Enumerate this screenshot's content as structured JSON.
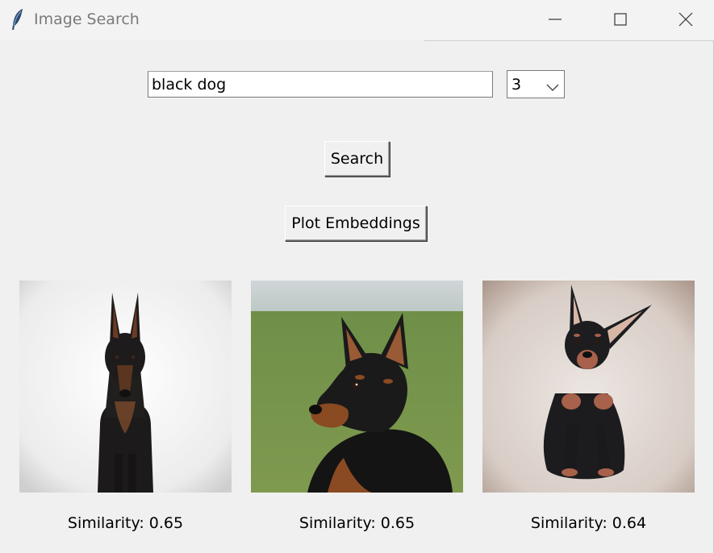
{
  "window": {
    "title": "Image Search",
    "icon": "feather-icon",
    "controls": [
      "minimize-icon",
      "maximize-icon",
      "close-icon"
    ]
  },
  "search": {
    "query": "black dog",
    "count_selected": "3",
    "search_label": "Search",
    "plot_label": "Plot Embeddings"
  },
  "results": [
    {
      "label": "Similarity: 0.65",
      "image": "doberman-front-white-background"
    },
    {
      "label": "Similarity: 0.65",
      "image": "miniature-pinscher-on-grass"
    },
    {
      "label": "Similarity: 0.64",
      "image": "miniature-pinscher-sitting-on-carpet"
    }
  ]
}
